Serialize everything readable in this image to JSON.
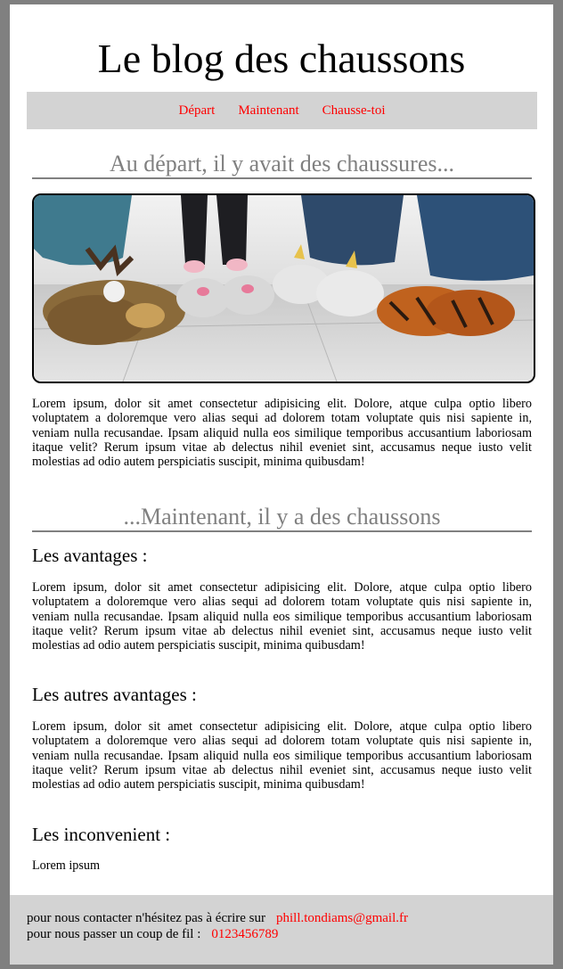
{
  "site": {
    "title": "Le blog des chaussons"
  },
  "nav": {
    "items": [
      "Départ",
      "Maintenant",
      "Chausse-toi"
    ]
  },
  "section1": {
    "title": "Au départ, il y avait des chaussures...",
    "paragraph": "Lorem ipsum, dolor sit amet consectetur adipisicing elit. Dolore, atque culpa optio libero voluptatem a doloremque vero alias sequi ad dolorem totam voluptate quis nisi sapiente in, veniam nulla recusandae. Ipsam aliquid nulla eos similique temporibus accusantium laboriosam itaque velit? Rerum ipsum vitae ab delectus nihil eveniet sint, accusamus neque iusto velit molestias ad odio autem perspiciatis suscipit, minima quibusdam!"
  },
  "section2": {
    "title": "...Maintenant, il y a des chaussons",
    "blocks": [
      {
        "heading": "Les avantages :",
        "text": "Lorem ipsum, dolor sit amet consectetur adipisicing elit. Dolore, atque culpa optio libero voluptatem a doloremque vero alias sequi ad dolorem totam voluptate quis nisi sapiente in, veniam nulla recusandae. Ipsam aliquid nulla eos similique temporibus accusantium laboriosam itaque velit? Rerum ipsum vitae ab delectus nihil eveniet sint, accusamus neque iusto velit molestias ad odio autem perspiciatis suscipit, minima quibusdam!"
      },
      {
        "heading": "Les autres avantages :",
        "text": "Lorem ipsum, dolor sit amet consectetur adipisicing elit. Dolore, atque culpa optio libero voluptatem a doloremque vero alias sequi ad dolorem totam voluptate quis nisi sapiente in, veniam nulla recusandae. Ipsam aliquid nulla eos similique temporibus accusantium laboriosam itaque velit? Rerum ipsum vitae ab delectus nihil eveniet sint, accusamus neque iusto velit molestias ad odio autem perspiciatis suscipit, minima quibusdam!"
      },
      {
        "heading": "Les inconvenient :",
        "text": "Lorem ipsum"
      }
    ]
  },
  "footer": {
    "contact_label": "pour nous contacter n'hésitez pas à écrire sur",
    "email": "phill.tondiams@gmail.fr",
    "phone_label": "pour nous passer un coup de fil :",
    "phone": "0123456789"
  },
  "colors": {
    "link": "#ff0000",
    "nav_bg": "#d3d3d3",
    "section_title": "#808080",
    "page_bg": "#808080"
  }
}
